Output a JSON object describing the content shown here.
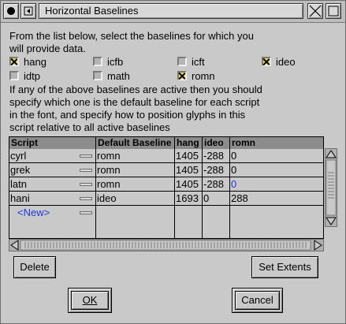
{
  "window": {
    "title": "Horizontal Baselines"
  },
  "intro": {
    "line1": "From the list below, select the baselines for which you",
    "line2": "will provide data."
  },
  "baselines": [
    {
      "label": "hang",
      "checked": true
    },
    {
      "label": "icfb",
      "checked": false
    },
    {
      "label": "icft",
      "checked": false
    },
    {
      "label": "ideo",
      "checked": true
    },
    {
      "label": "idtp",
      "checked": false
    },
    {
      "label": "math",
      "checked": false
    },
    {
      "label": "romn",
      "checked": true
    }
  ],
  "note": {
    "line1": "If any of the above baselines are active then you should",
    "line2": "specify which one is the default baseline for each script",
    "line3": "in the font, and specify how to position glyphs in this",
    "line4": "script relative to all active baselines"
  },
  "table": {
    "headers": [
      "Script",
      "Default Baseline",
      "hang",
      "ideo",
      "romn"
    ],
    "rows": [
      {
        "script": "cyrl",
        "default": "romn",
        "hang": "1405",
        "ideo": "-288",
        "romn": "0"
      },
      {
        "script": "grek",
        "default": "romn",
        "hang": "1405",
        "ideo": "-288",
        "romn": "0"
      },
      {
        "script": "latn",
        "default": "romn",
        "hang": "1405",
        "ideo": "-288",
        "romn": "0"
      },
      {
        "script": "hani",
        "default": "ideo",
        "hang": "1693",
        "ideo": "0",
        "romn": "288"
      }
    ],
    "new_label": "<New>"
  },
  "buttons": {
    "delete": "Delete",
    "set_extents": "Set Extents",
    "ok": "OK",
    "cancel": "Cancel"
  },
  "colors": {
    "checked_fill": "#e8d850",
    "link_blue": "#1f3ae0",
    "header_bg": "#8c8c8c"
  }
}
